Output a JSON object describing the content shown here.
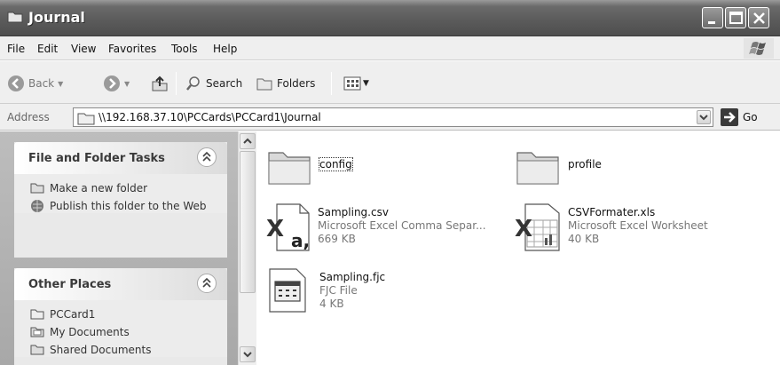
{
  "window": {
    "title": "Journal"
  },
  "menu": [
    "File",
    "Edit",
    "View",
    "Favorites",
    "Tools",
    "Help"
  ],
  "toolbar": {
    "back": "Back",
    "search": "Search",
    "folders": "Folders"
  },
  "address": {
    "label": "Address",
    "path": "\\\\192.168.37.10\\PCCards\\PCCard1\\Journal",
    "go": "Go"
  },
  "tasks_panel": {
    "title": "File and Folder Tasks",
    "items": [
      "Make a new folder",
      "Publish this folder to the Web"
    ]
  },
  "places_panel": {
    "title": "Other Places",
    "items": [
      "PCCard1",
      "My Documents",
      "Shared Documents"
    ]
  },
  "files": [
    {
      "name": "config",
      "type": "",
      "size": ""
    },
    {
      "name": "profile",
      "type": "",
      "size": ""
    },
    {
      "name": "Sampling.csv",
      "type": "Microsoft Excel Comma Separ...",
      "size": "669 KB"
    },
    {
      "name": "CSVFormater.xls",
      "type": "Microsoft Excel Worksheet",
      "size": "40 KB"
    },
    {
      "name": "Sampling.fjc",
      "type": "FJC File",
      "size": "4 KB"
    }
  ],
  "icons": [
    "folder-icon",
    "minimize-icon",
    "maximize-icon",
    "close-icon",
    "windows-flag-icon",
    "back-arrow-icon",
    "forward-arrow-icon",
    "up-folder-icon",
    "search-icon",
    "folders-icon",
    "views-icon",
    "go-arrow-icon",
    "new-folder-icon",
    "publish-web-icon",
    "drive-icon",
    "my-documents-icon",
    "shared-documents-icon",
    "csv-file-icon",
    "xls-file-icon",
    "fjc-file-icon",
    "collapse-chevron-icon"
  ]
}
